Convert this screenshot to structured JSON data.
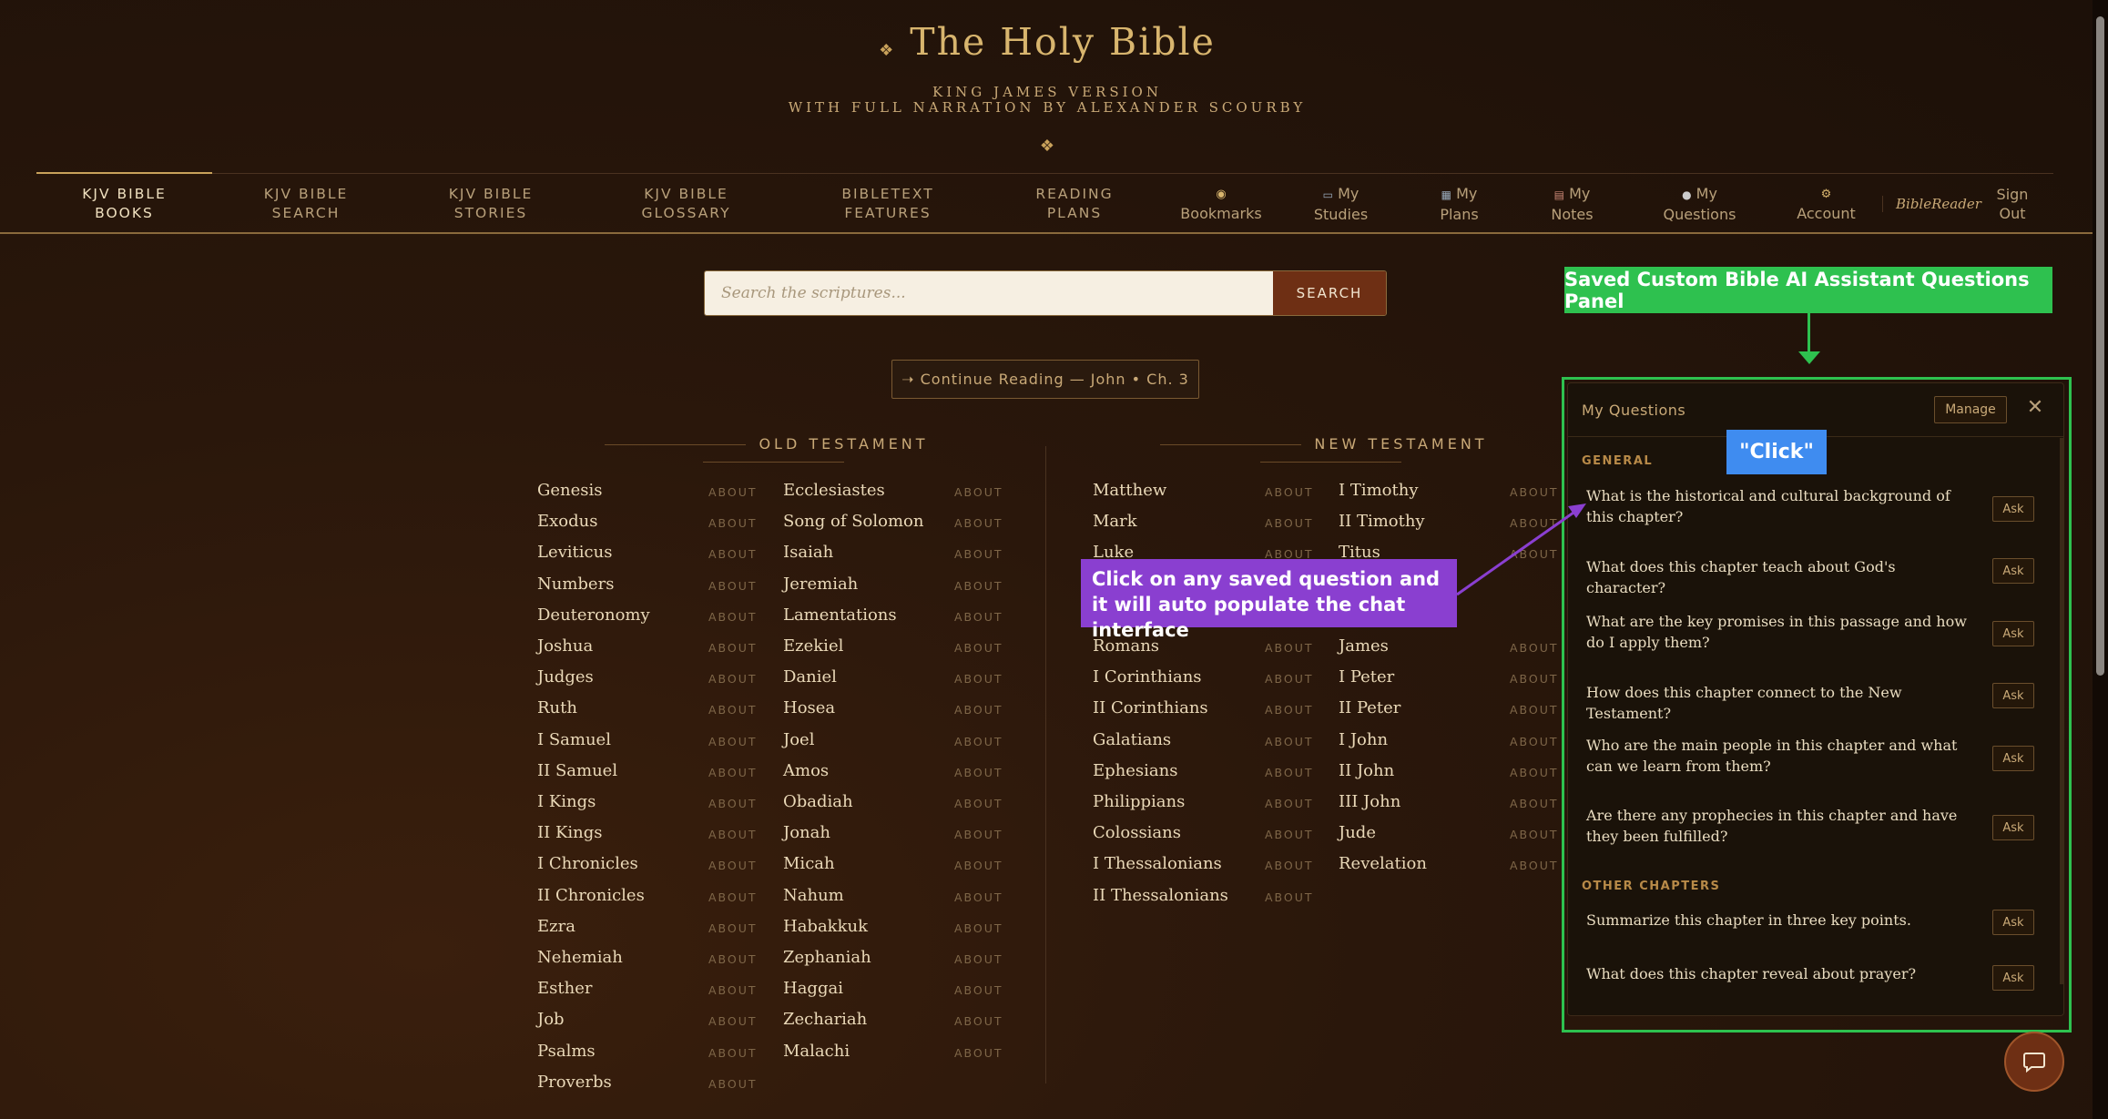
{
  "header": {
    "title": "The Holy Bible",
    "subtitle_line1": "KING JAMES VERSION",
    "subtitle_line2": "WITH FULL NARRATION BY ALEXANDER SCOURBY",
    "ornament": "❖"
  },
  "nav": {
    "books": [
      "KJV BIBLE",
      "BOOKS"
    ],
    "search": [
      "KJV BIBLE",
      "SEARCH"
    ],
    "stories": [
      "KJV BIBLE",
      "STORIES"
    ],
    "glossary": [
      "KJV BIBLE",
      "GLOSSARY"
    ],
    "features": [
      "BIBLETEXT",
      "FEATURES"
    ],
    "plans": [
      "READING",
      "PLANS"
    ],
    "bookmarks": "Bookmarks",
    "my_studies": [
      "My",
      "Studies"
    ],
    "my_plans": [
      "My",
      "Plans"
    ],
    "my_notes": [
      "My",
      "Notes"
    ],
    "my_questions": [
      "My",
      "Questions"
    ],
    "account": "Account",
    "bible_reader": "BibleReader",
    "sign_out": [
      "Sign",
      "Out"
    ]
  },
  "search": {
    "placeholder": "Search the scriptures...",
    "button": "SEARCH"
  },
  "continue_reading": "➝ Continue Reading — John • Ch. 3",
  "old_testament": {
    "heading": "OLD TESTAMENT",
    "col1": [
      "Genesis",
      "Exodus",
      "Leviticus",
      "Numbers",
      "Deuteronomy",
      "Joshua",
      "Judges",
      "Ruth",
      "I Samuel",
      "II Samuel",
      "I Kings",
      "II Kings",
      "I Chronicles",
      "II Chronicles",
      "Ezra",
      "Nehemiah",
      "Esther",
      "Job",
      "Psalms",
      "Proverbs"
    ],
    "col2": [
      "Ecclesiastes",
      "Song of Solomon",
      "Isaiah",
      "Jeremiah",
      "Lamentations",
      "Ezekiel",
      "Daniel",
      "Hosea",
      "Joel",
      "Amos",
      "Obadiah",
      "Jonah",
      "Micah",
      "Nahum",
      "Habakkuk",
      "Zephaniah",
      "Haggai",
      "Zechariah",
      "Malachi"
    ]
  },
  "new_testament": {
    "heading": "NEW TESTAMENT",
    "col1": [
      "Matthew",
      "Mark",
      "Luke",
      "",
      "",
      "Romans",
      "I Corinthians",
      "II Corinthians",
      "Galatians",
      "Ephesians",
      "Philippians",
      "Colossians",
      "I Thessalonians",
      "II Thessalonians"
    ],
    "col2": [
      "I Timothy",
      "II Timothy",
      "Titus",
      "",
      "",
      "James",
      "I Peter",
      "II Peter",
      "I John",
      "II John",
      "III John",
      "Jude",
      "Revelation"
    ]
  },
  "about_label": "ABOUT",
  "questions_panel": {
    "title": "My Questions",
    "manage": "Manage",
    "close": "✕",
    "general_heading": "GENERAL",
    "general": [
      "What is the historical and cultural background of this chapter?",
      "What does this chapter teach about God's character?",
      "What are the key promises in this passage and how do I apply them?",
      "How does this chapter connect to the New Testament?",
      "Who are the main people in this chapter and what can we learn from them?",
      "Are there any prophecies in this chapter and have they been fulfilled?"
    ],
    "other_heading": "OTHER CHAPTERS",
    "other": [
      "Summarize this chapter in three key points.",
      "What does this chapter reveal about prayer?"
    ],
    "ask_label": "Ask"
  },
  "annotations": {
    "panel_label": "Saved Custom Bible AI Assistant Questions Panel",
    "click_label": "\"Click\"",
    "hint": "Click on any saved question and it will auto populate the chat interface",
    "green": "#2ec14f",
    "purple": "#8a3fd0",
    "blue": "#3f8cf0"
  },
  "icons": {
    "bookmarks": "bookmark-icon",
    "studies": "book-icon",
    "plans": "chart-icon",
    "notes": "note-icon",
    "questions": "speech-bubble-icon",
    "account": "gear-icon",
    "chat": "chat-icon"
  }
}
